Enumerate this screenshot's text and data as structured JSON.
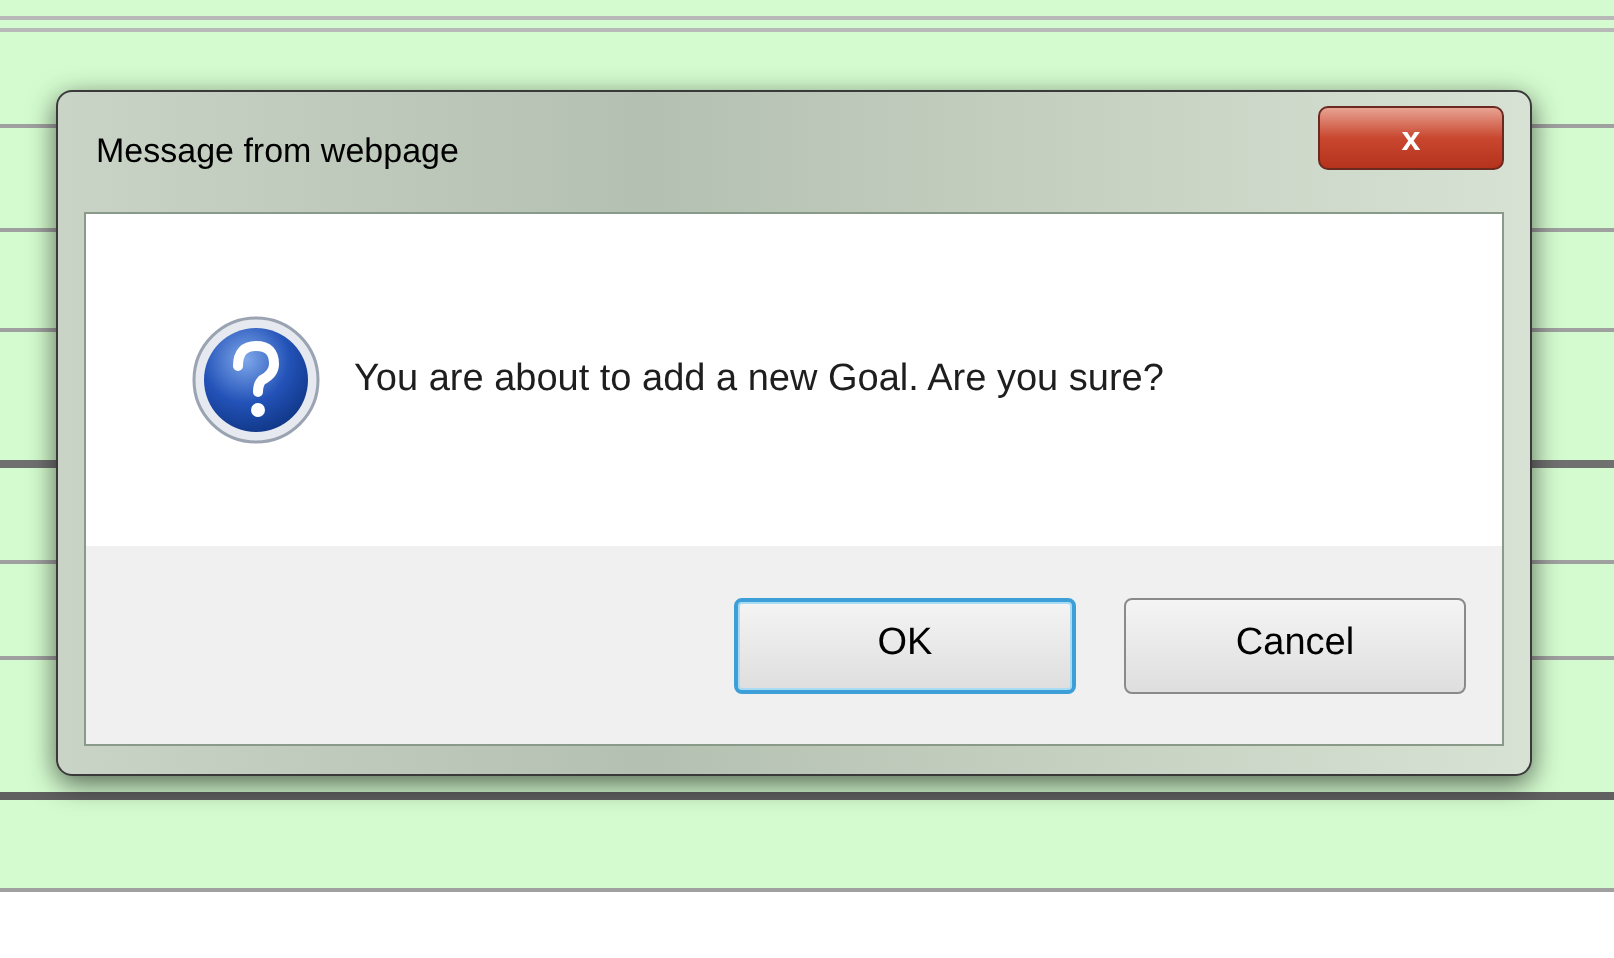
{
  "dialog": {
    "title": "Message from webpage",
    "close": "x",
    "message": "You are about to add a new Goal. Are you sure?",
    "buttons": [
      {
        "label": "OK",
        "selected": true
      },
      {
        "label": "Cancel",
        "selected": false
      }
    ]
  }
}
